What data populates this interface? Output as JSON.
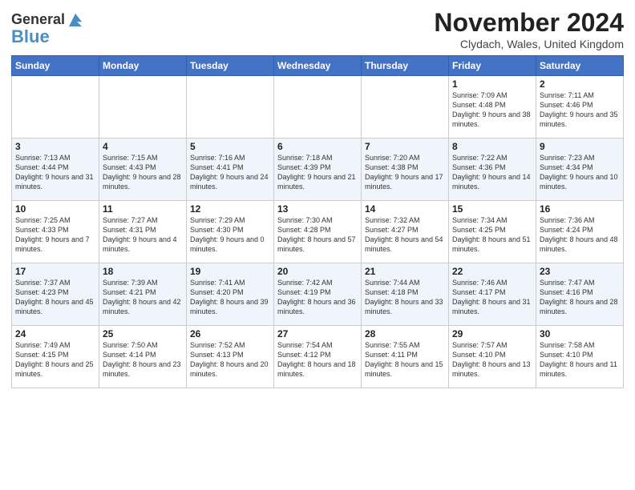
{
  "logo": {
    "line1": "General",
    "line2": "Blue"
  },
  "header": {
    "month": "November 2024",
    "location": "Clydach, Wales, United Kingdom"
  },
  "weekdays": [
    "Sunday",
    "Monday",
    "Tuesday",
    "Wednesday",
    "Thursday",
    "Friday",
    "Saturday"
  ],
  "weeks": [
    [
      {
        "day": "",
        "info": ""
      },
      {
        "day": "",
        "info": ""
      },
      {
        "day": "",
        "info": ""
      },
      {
        "day": "",
        "info": ""
      },
      {
        "day": "",
        "info": ""
      },
      {
        "day": "1",
        "info": "Sunrise: 7:09 AM\nSunset: 4:48 PM\nDaylight: 9 hours and 38 minutes."
      },
      {
        "day": "2",
        "info": "Sunrise: 7:11 AM\nSunset: 4:46 PM\nDaylight: 9 hours and 35 minutes."
      }
    ],
    [
      {
        "day": "3",
        "info": "Sunrise: 7:13 AM\nSunset: 4:44 PM\nDaylight: 9 hours and 31 minutes."
      },
      {
        "day": "4",
        "info": "Sunrise: 7:15 AM\nSunset: 4:43 PM\nDaylight: 9 hours and 28 minutes."
      },
      {
        "day": "5",
        "info": "Sunrise: 7:16 AM\nSunset: 4:41 PM\nDaylight: 9 hours and 24 minutes."
      },
      {
        "day": "6",
        "info": "Sunrise: 7:18 AM\nSunset: 4:39 PM\nDaylight: 9 hours and 21 minutes."
      },
      {
        "day": "7",
        "info": "Sunrise: 7:20 AM\nSunset: 4:38 PM\nDaylight: 9 hours and 17 minutes."
      },
      {
        "day": "8",
        "info": "Sunrise: 7:22 AM\nSunset: 4:36 PM\nDaylight: 9 hours and 14 minutes."
      },
      {
        "day": "9",
        "info": "Sunrise: 7:23 AM\nSunset: 4:34 PM\nDaylight: 9 hours and 10 minutes."
      }
    ],
    [
      {
        "day": "10",
        "info": "Sunrise: 7:25 AM\nSunset: 4:33 PM\nDaylight: 9 hours and 7 minutes."
      },
      {
        "day": "11",
        "info": "Sunrise: 7:27 AM\nSunset: 4:31 PM\nDaylight: 9 hours and 4 minutes."
      },
      {
        "day": "12",
        "info": "Sunrise: 7:29 AM\nSunset: 4:30 PM\nDaylight: 9 hours and 0 minutes."
      },
      {
        "day": "13",
        "info": "Sunrise: 7:30 AM\nSunset: 4:28 PM\nDaylight: 8 hours and 57 minutes."
      },
      {
        "day": "14",
        "info": "Sunrise: 7:32 AM\nSunset: 4:27 PM\nDaylight: 8 hours and 54 minutes."
      },
      {
        "day": "15",
        "info": "Sunrise: 7:34 AM\nSunset: 4:25 PM\nDaylight: 8 hours and 51 minutes."
      },
      {
        "day": "16",
        "info": "Sunrise: 7:36 AM\nSunset: 4:24 PM\nDaylight: 8 hours and 48 minutes."
      }
    ],
    [
      {
        "day": "17",
        "info": "Sunrise: 7:37 AM\nSunset: 4:23 PM\nDaylight: 8 hours and 45 minutes."
      },
      {
        "day": "18",
        "info": "Sunrise: 7:39 AM\nSunset: 4:21 PM\nDaylight: 8 hours and 42 minutes."
      },
      {
        "day": "19",
        "info": "Sunrise: 7:41 AM\nSunset: 4:20 PM\nDaylight: 8 hours and 39 minutes."
      },
      {
        "day": "20",
        "info": "Sunrise: 7:42 AM\nSunset: 4:19 PM\nDaylight: 8 hours and 36 minutes."
      },
      {
        "day": "21",
        "info": "Sunrise: 7:44 AM\nSunset: 4:18 PM\nDaylight: 8 hours and 33 minutes."
      },
      {
        "day": "22",
        "info": "Sunrise: 7:46 AM\nSunset: 4:17 PM\nDaylight: 8 hours and 31 minutes."
      },
      {
        "day": "23",
        "info": "Sunrise: 7:47 AM\nSunset: 4:16 PM\nDaylight: 8 hours and 28 minutes."
      }
    ],
    [
      {
        "day": "24",
        "info": "Sunrise: 7:49 AM\nSunset: 4:15 PM\nDaylight: 8 hours and 25 minutes."
      },
      {
        "day": "25",
        "info": "Sunrise: 7:50 AM\nSunset: 4:14 PM\nDaylight: 8 hours and 23 minutes."
      },
      {
        "day": "26",
        "info": "Sunrise: 7:52 AM\nSunset: 4:13 PM\nDaylight: 8 hours and 20 minutes."
      },
      {
        "day": "27",
        "info": "Sunrise: 7:54 AM\nSunset: 4:12 PM\nDaylight: 8 hours and 18 minutes."
      },
      {
        "day": "28",
        "info": "Sunrise: 7:55 AM\nSunset: 4:11 PM\nDaylight: 8 hours and 15 minutes."
      },
      {
        "day": "29",
        "info": "Sunrise: 7:57 AM\nSunset: 4:10 PM\nDaylight: 8 hours and 13 minutes."
      },
      {
        "day": "30",
        "info": "Sunrise: 7:58 AM\nSunset: 4:10 PM\nDaylight: 8 hours and 11 minutes."
      }
    ]
  ]
}
